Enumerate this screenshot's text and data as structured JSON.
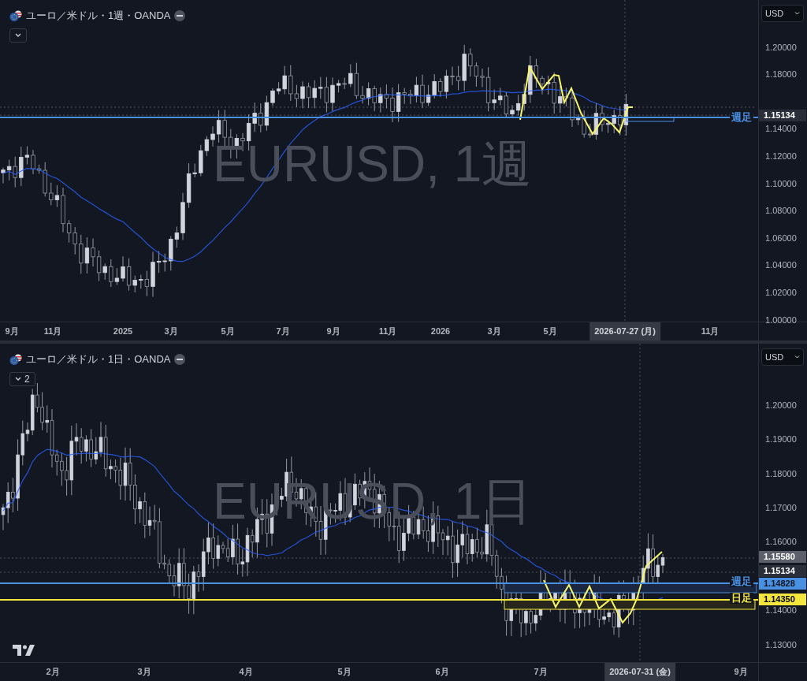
{
  "panes": [
    {
      "title": "ユーロ／米ドル・1週・OANDA",
      "watermark": "EURUSD, 1週",
      "currency": "USD",
      "price_ticks": [
        "1.20000",
        "1.18000",
        "1.14000",
        "1.12000",
        "1.10000",
        "1.08000",
        "1.06000",
        "1.04000",
        "1.02000",
        "1.00000"
      ],
      "price_labels": [
        {
          "text": "1.15134",
          "kind": "current"
        }
      ],
      "line_labels": [
        {
          "text": "週足",
          "color": "#4a90e2"
        }
      ],
      "time_ticks": [
        "9月",
        "11月",
        "2025",
        "3月",
        "5月",
        "7月",
        "9月",
        "11月",
        "2026",
        "3月",
        "5月",
        "11月"
      ],
      "crosshair_time": "2026-07-27 (月)"
    },
    {
      "title": "ユーロ／米ドル・1日・OANDA",
      "watermark": "EURUSD, 1日",
      "currency": "USD",
      "legend_count": "2",
      "price_ticks": [
        "1.20000",
        "1.19000",
        "1.18000",
        "1.17000",
        "1.16000",
        "1.14000",
        "1.13000"
      ],
      "price_labels": [
        {
          "text": "1.15580",
          "kind": "last"
        },
        {
          "text": "1.15134",
          "kind": "current"
        },
        {
          "text": "1.14828",
          "kind": "weekly"
        },
        {
          "text": "1.14350",
          "kind": "daily"
        }
      ],
      "line_labels": [
        {
          "text": "週足",
          "color": "#4a90e2"
        },
        {
          "text": "日足",
          "color": "#f5e63d"
        }
      ],
      "time_ticks": [
        "2月",
        "3月",
        "4月",
        "5月",
        "6月",
        "7月",
        "9月"
      ],
      "crosshair_time": "2026-07-31 (金)"
    }
  ]
}
